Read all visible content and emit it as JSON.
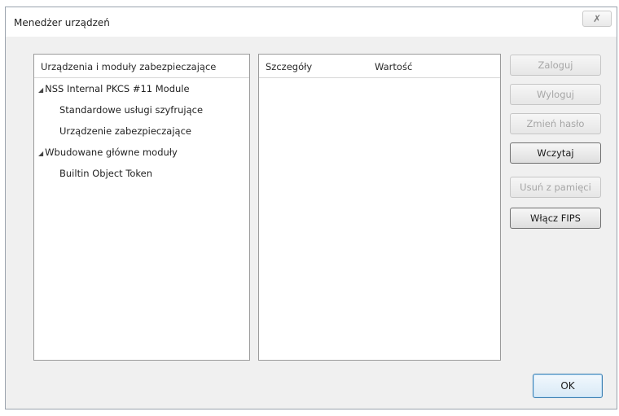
{
  "window": {
    "title": "Menedżer urządzeń",
    "close_glyph": "✗"
  },
  "left_panel": {
    "header": "Urządzenia i moduły zabezpieczające",
    "items": [
      {
        "label": "NSS Internal PKCS #11 Module",
        "expanded": true,
        "level": 0
      },
      {
        "label": "Standardowe usługi szyfrujące",
        "level": 1
      },
      {
        "label": "Urządzenie zabezpieczające",
        "level": 1
      },
      {
        "label": "Wbudowane główne moduły",
        "expanded": true,
        "level": 0
      },
      {
        "label": "Builtin Object Token",
        "level": 1
      }
    ]
  },
  "right_panel": {
    "columns": [
      "Szczegóły",
      "Wartość"
    ]
  },
  "buttons": {
    "login": "Zaloguj",
    "logout": "Wyloguj",
    "change_password": "Zmień hasło",
    "load": "Wczytaj",
    "unload": "Usuń z pamięci",
    "enable_fips": "Włącz FIPS",
    "ok": "OK"
  },
  "colors": {
    "dialog_bg": "#f0f0f0",
    "disabled_text": "#a6a6a6",
    "ok_border": "#3c7fb1"
  },
  "icons": {
    "close": "close-icon",
    "expanded": "expanded-triangle-icon"
  }
}
